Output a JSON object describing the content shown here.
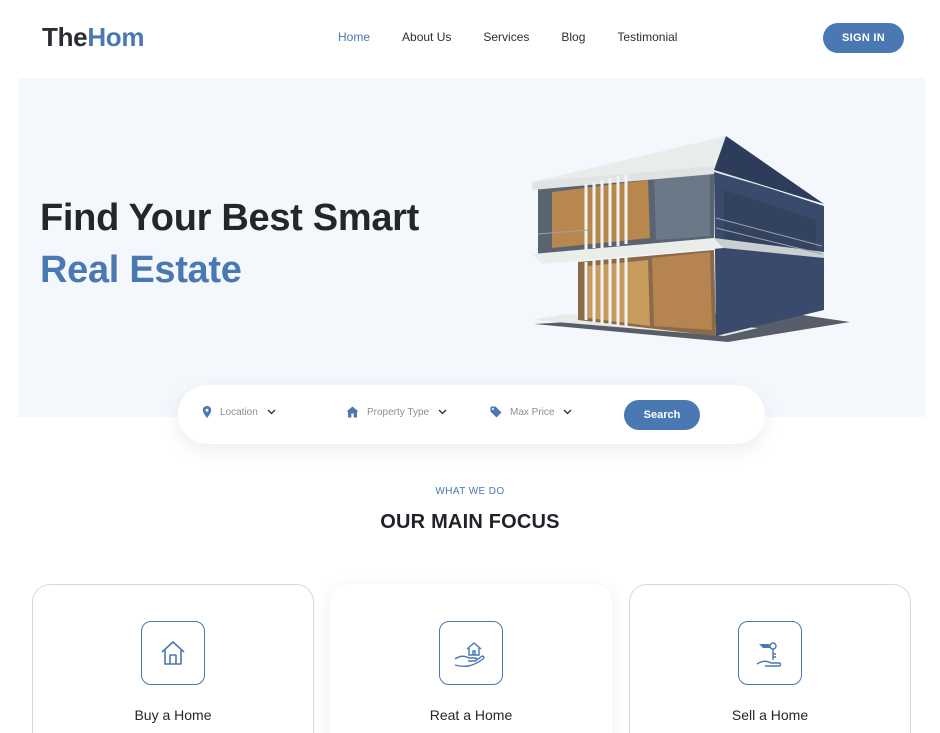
{
  "header": {
    "logo_part1": "The",
    "logo_part2": "Hom",
    "nav": [
      "Home",
      "About Us",
      "Services",
      "Blog",
      "Testimonial"
    ],
    "active_nav": "Home",
    "signin_label": "SIGN IN"
  },
  "hero": {
    "title": "Find Your Best Smart",
    "subtitle": "Real Estate"
  },
  "search": {
    "location_label": "Location",
    "property_type_label": "Property Type",
    "max_price_label": "Max Price",
    "search_label": "Search"
  },
  "section": {
    "eyebrow": "WHAT WE DO",
    "title": "OUR MAIN FOCUS"
  },
  "cards": [
    {
      "label": "Buy a Home",
      "icon": "house-icon"
    },
    {
      "label": "Reat a Home",
      "icon": "hand-house-icon"
    },
    {
      "label": "Sell a Home",
      "icon": "hand-key-icon"
    }
  ],
  "colors": {
    "accent": "#4a78b2",
    "hero_bg": "#f4f8fd",
    "text_dark": "#23272b"
  }
}
